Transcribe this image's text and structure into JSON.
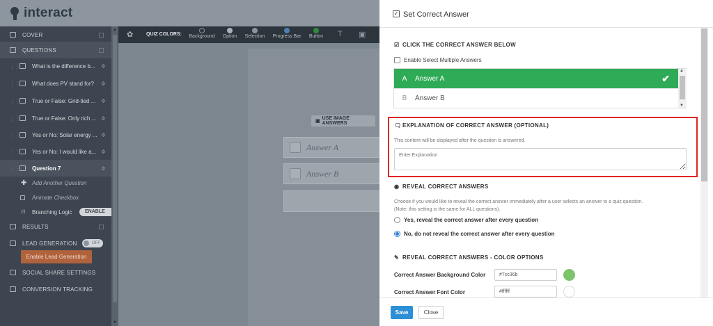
{
  "app": {
    "logo_text": "interact"
  },
  "sidebar": {
    "cover": "COVER",
    "questions": "QUESTIONS",
    "question_items": [
      "What is the difference b...",
      "What does PV stand for?",
      "True or False: Grid-tied ...",
      "True or False: Only rich ...",
      "Yes or No: Solar energy ...",
      "Yes or No: I would like a...",
      "Question 7"
    ],
    "add_question": "Add Another Question",
    "animate_checkbox": "Animate Checkbox",
    "branching_logic": "Branching Logic",
    "branching_toggle": "ENABLE",
    "results": "RESULTS",
    "lead_generation": "LEAD GENERATION",
    "lead_toggle": "OFF",
    "enable_lead_button": "Enable Lead Generation",
    "social_share": "SOCIAL SHARE SETTINGS",
    "conversion_tracking": "CONVERSION TRACKING"
  },
  "toolbar": {
    "quiz_colors_label": "QUIZ COLORS:",
    "swatches": [
      {
        "label": "Background",
        "color": "#2c343c"
      },
      {
        "label": "Option",
        "color": "#aab2b9"
      },
      {
        "label": "Selection",
        "color": "#8c959e"
      },
      {
        "label": "Progress Bar",
        "color": "#4d7fb3"
      },
      {
        "label": "Button",
        "color": "#2f8a3e"
      }
    ]
  },
  "canvas": {
    "use_image_answers": "USE IMAGE ANSWERS",
    "answers": [
      "Answer A",
      "Answer B"
    ]
  },
  "modal": {
    "title": "Set Correct Answer",
    "click_correct_title": "CLICK THE CORRECT ANSWER BELOW",
    "enable_multiple": "Enable Select Multiple Answers",
    "answers": [
      {
        "letter": "A",
        "text": "Answer A",
        "selected": true
      },
      {
        "letter": "B",
        "text": "Answer B",
        "selected": false
      }
    ],
    "explanation_title": "EXPLANATION OF CORRECT ANSWER (OPTIONAL)",
    "explanation_desc": "This content will be displayed after the question is answered.",
    "explanation_placeholder": "Enter Explanation",
    "reveal_title": "REVEAL CORRECT ANSWERS",
    "reveal_desc_1": "Choose if you would like to reveal the correct answer immediately after a user selects an answer to a quiz question.",
    "reveal_desc_2": "(Note: this setting is the same for ALL questions).",
    "reveal_yes": "Yes, reveal the correct answer after every question",
    "reveal_no": "No, do not reveal the correct answer after every question",
    "color_options_title": "REVEAL CORRECT ANSWERS - COLOR OPTIONS",
    "bg_color_label": "Correct Answer Background Color",
    "bg_color_value": "#7cc36b",
    "font_color_label": "Correct Answer Font Color",
    "font_color_value": "#ffffff",
    "save": "Save",
    "close": "Close"
  },
  "colors": {
    "selected_green": "#2fab57",
    "highlight_red": "#e02525",
    "save_blue": "#2d8fd5",
    "bg_swatch": "#7cc36b",
    "font_swatch": "#ffffff"
  }
}
